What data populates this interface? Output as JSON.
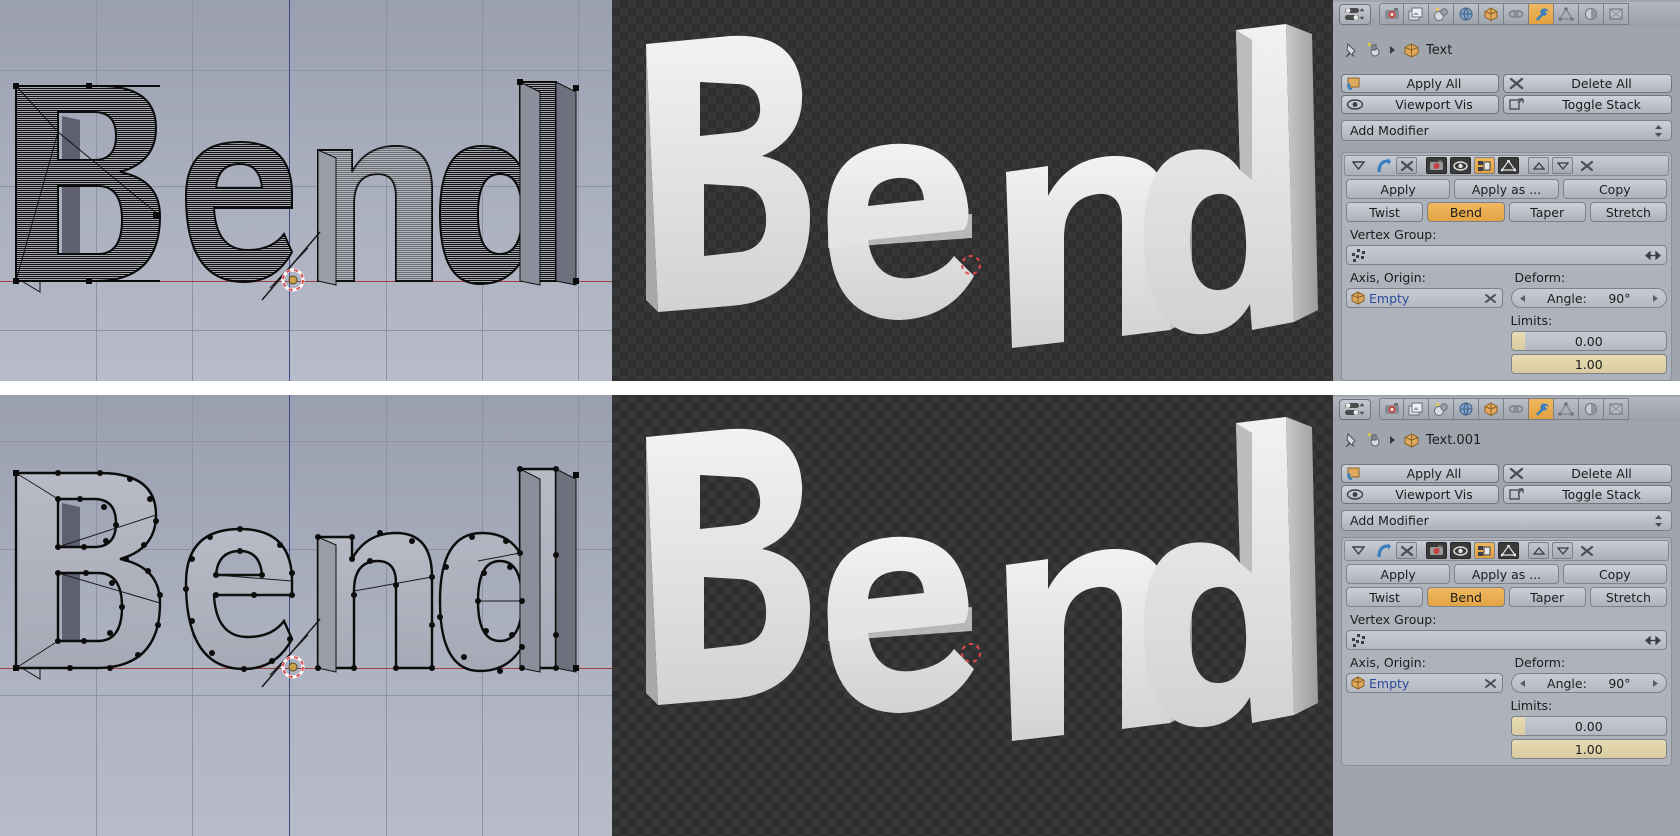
{
  "app": "Blender",
  "panels": [
    {
      "id": "top",
      "object_name": "Text",
      "properties_tabs": [
        "render-icon",
        "scene-icon",
        "world-icon",
        "object-icon",
        "constraint-icon",
        "wrench-icon",
        "physics-icon",
        "material-icon",
        "texture-icon"
      ],
      "active_tab": "wrench-icon",
      "stack_buttons": {
        "apply_all": "Apply All",
        "delete_all": "Delete All",
        "viewport_vis": "Viewport Vis",
        "toggle_stack": "Toggle Stack"
      },
      "add_modifier": "Add Modifier",
      "modifier": {
        "apply": "Apply",
        "apply_as": "Apply as ...",
        "copy": "Copy",
        "types": [
          "Twist",
          "Bend",
          "Taper",
          "Stretch"
        ],
        "active_type": "Bend",
        "vertex_group_label": "Vertex Group:",
        "vertex_group_value": "",
        "axis_origin_label": "Axis, Origin:",
        "axis_origin_value": "Empty",
        "deform_label": "Deform:",
        "angle_label": "Angle:",
        "angle_value": "90°",
        "limits_label": "Limits:",
        "limit_low": "0.00",
        "limit_high": "1.00"
      },
      "viewport_edit": {
        "text": "Bend",
        "mode": "edit-mode-wireframe-dense"
      },
      "viewport_render": {
        "text": "Bend",
        "mode": "solid-shaded"
      }
    },
    {
      "id": "bottom",
      "object_name": "Text.001",
      "properties_tabs": [
        "render-icon",
        "scene-icon",
        "world-icon",
        "object-icon",
        "constraint-icon",
        "wrench-icon",
        "physics-icon",
        "material-icon",
        "texture-icon"
      ],
      "active_tab": "wrench-icon",
      "stack_buttons": {
        "apply_all": "Apply All",
        "delete_all": "Delete All",
        "viewport_vis": "Viewport Vis",
        "toggle_stack": "Toggle Stack"
      },
      "add_modifier": "Add Modifier",
      "modifier": {
        "apply": "Apply",
        "apply_as": "Apply as ...",
        "copy": "Copy",
        "types": [
          "Twist",
          "Bend",
          "Taper",
          "Stretch"
        ],
        "active_type": "Bend",
        "vertex_group_label": "Vertex Group:",
        "vertex_group_value": "",
        "axis_origin_label": "Axis, Origin:",
        "axis_origin_value": "Empty",
        "deform_label": "Deform:",
        "angle_label": "Angle:",
        "angle_value": "90°",
        "limits_label": "Limits:",
        "limit_low": "0.00",
        "limit_high": "1.00"
      },
      "viewport_edit": {
        "text": "Bend",
        "mode": "edit-mode-vertices"
      },
      "viewport_render": {
        "text": "Bend",
        "mode": "solid-shaded"
      }
    }
  ],
  "colors": {
    "accent": "#e8a93f",
    "panel_bg": "#a0a4ad",
    "viewport_bg": "#aab0bf",
    "render_bg": "#383838",
    "x_axis": "#9c4040",
    "y_axis": "#3c4a8c",
    "cursor": "#e04b4b"
  }
}
